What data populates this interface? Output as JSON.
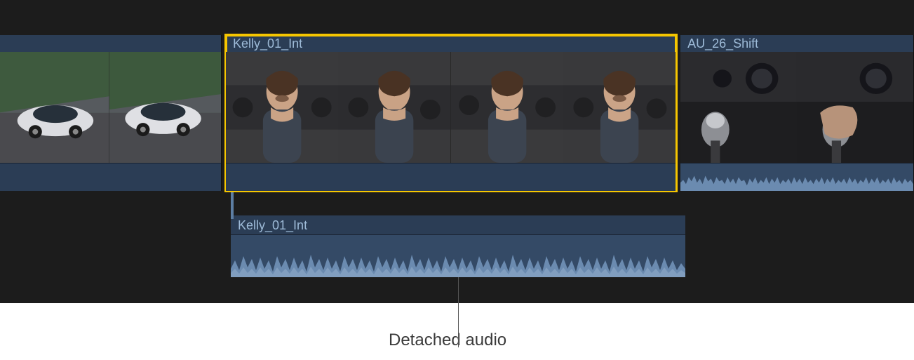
{
  "clips": {
    "clip1": {
      "label": ""
    },
    "clip2": {
      "label": "Kelly_01_Int"
    },
    "clip3": {
      "label": "AU_26_Shift"
    }
  },
  "detached_audio": {
    "label": "Kelly_01_Int"
  },
  "callout": {
    "text": "Detached audio"
  },
  "colors": {
    "selection": "#f6c600",
    "clip_bg": "#2b3d55",
    "audio_bg": "#344a66",
    "label_text": "#9ebbd8"
  }
}
